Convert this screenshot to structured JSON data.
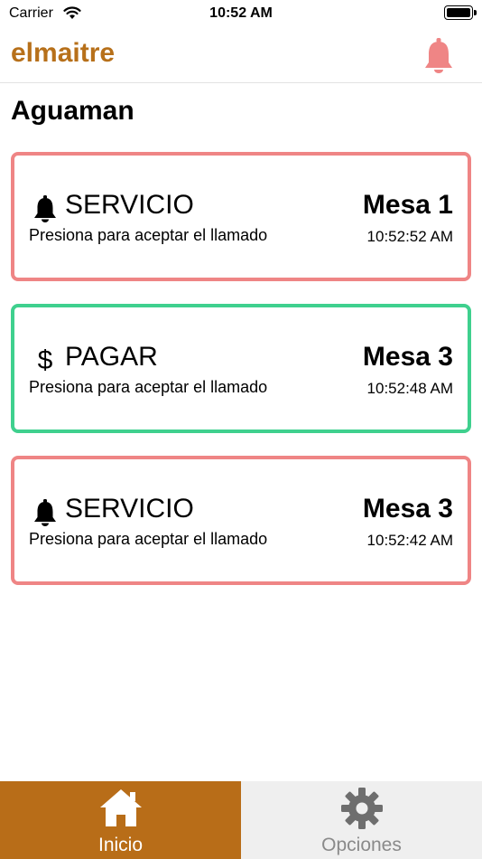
{
  "status_bar": {
    "carrier": "Carrier",
    "time": "10:52 AM",
    "wifi_icon": "wifi-icon",
    "battery_icon": "battery-icon"
  },
  "nav": {
    "brand": "elmaitre",
    "bell_icon": "bell-icon"
  },
  "page": {
    "title": "Aguaman"
  },
  "calls": [
    {
      "type": "SERVICIO",
      "icon": "bell-icon",
      "hint": "Presiona para aceptar el llamado",
      "table": "Mesa 1",
      "time": "10:52:52 AM",
      "status_color": "#ef8585"
    },
    {
      "type": "PAGAR",
      "icon": "dollar-icon",
      "icon_glyph": "$",
      "hint": "Presiona para aceptar el llamado",
      "table": "Mesa 3",
      "time": "10:52:48 AM",
      "status_color": "#3fd08e"
    },
    {
      "type": "SERVICIO",
      "icon": "bell-icon",
      "hint": "Presiona para aceptar el llamado",
      "table": "Mesa 3",
      "time": "10:52:42 AM",
      "status_color": "#ef8585"
    }
  ],
  "tabs": [
    {
      "label": "Inicio",
      "icon": "home-icon",
      "active": true
    },
    {
      "label": "Opciones",
      "icon": "gear-icon",
      "active": false
    }
  ],
  "colors": {
    "brand": "#b7701a",
    "active_tab": "#b86d18",
    "inactive_tab": "#efefef",
    "service_border": "#ef8585",
    "pay_border": "#3fd08e"
  }
}
